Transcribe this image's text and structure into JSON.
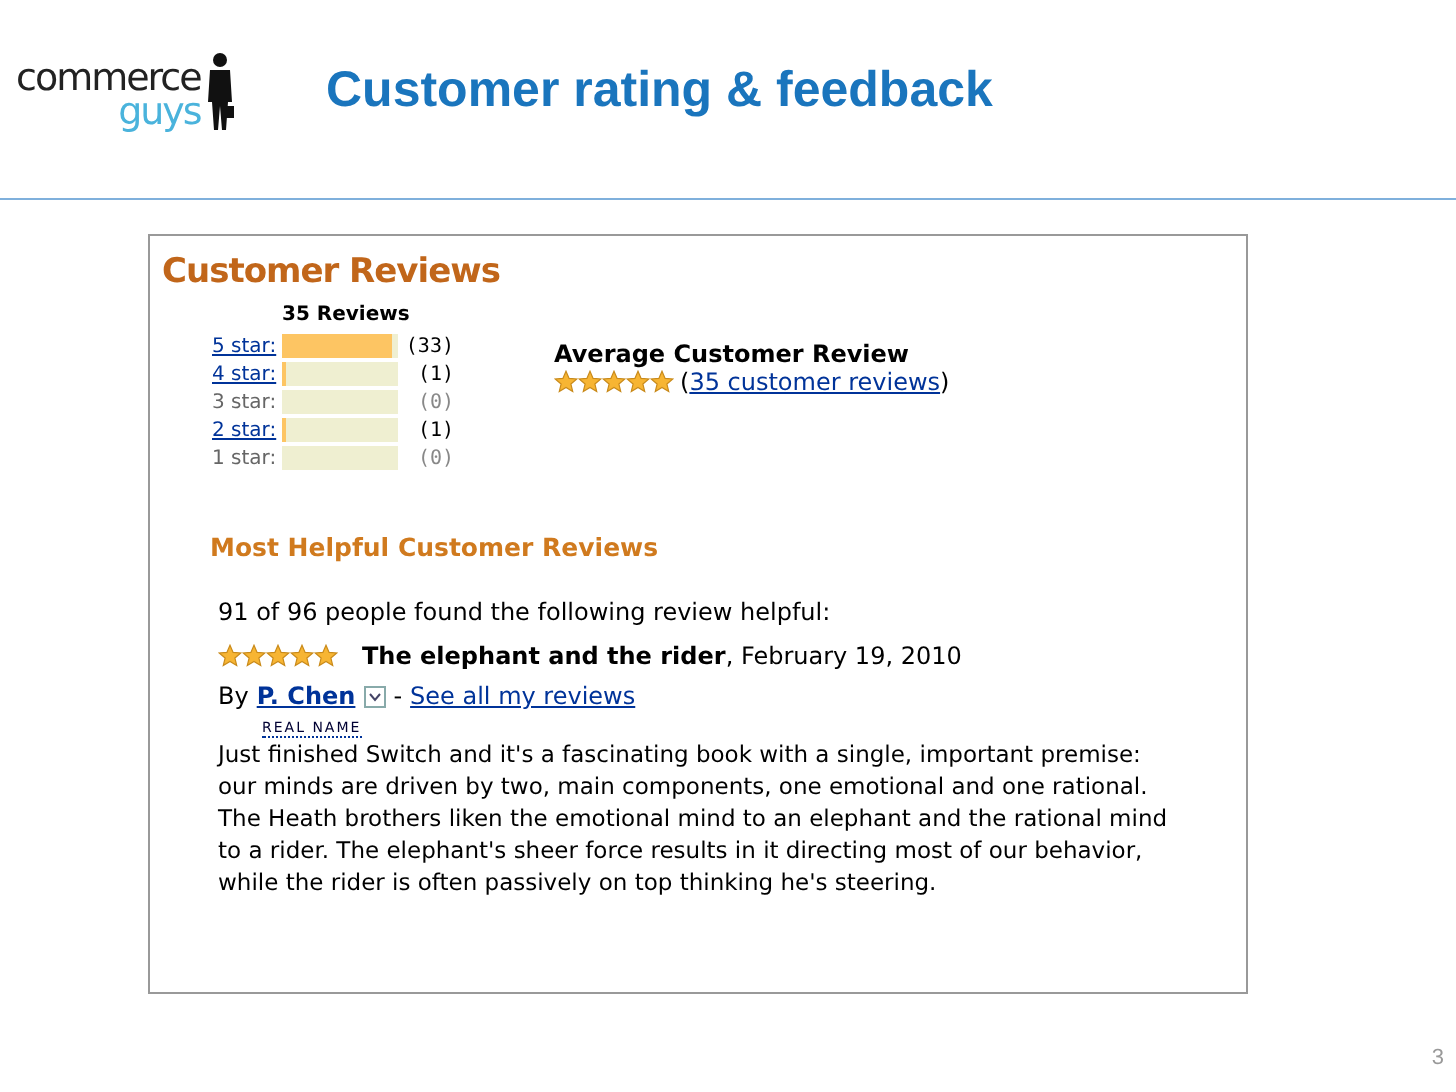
{
  "logo": {
    "line1": "commerce",
    "line2": "guys"
  },
  "title": "Customer rating & feedback",
  "reviews_panel": {
    "heading": "Customer Reviews",
    "total": "35 Reviews",
    "histogram": [
      {
        "label": "5 star:",
        "link": true,
        "level": 0.94,
        "count": "(33)"
      },
      {
        "label": "4 star:",
        "link": true,
        "level": 0.03,
        "count": "(1)"
      },
      {
        "label": "3 star:",
        "link": false,
        "level": 0,
        "count": "(0)"
      },
      {
        "label": "2 star:",
        "link": true,
        "level": 0.03,
        "count": "(1)"
      },
      {
        "label": "1 star:",
        "link": false,
        "level": 0,
        "count": "(0)"
      }
    ],
    "average": {
      "heading": "Average Customer Review",
      "stars": 5,
      "open": "(",
      "link": "35 customer reviews",
      "close": ")"
    },
    "helpful_heading": "Most Helpful Customer Reviews",
    "review": {
      "helpful": "91 of 96 people found the following review helpful:",
      "stars": 5,
      "title": "The elephant and the rider",
      "date": ", February 19, 2010",
      "by": "By",
      "author": "P. Chen",
      "separator": "-",
      "see_all": "See all my reviews",
      "badge": "REAL NAME",
      "body": "Just finished Switch and it's a fascinating book with a single, important premise: our minds are driven by two, main components, one emotional and one rational. The Heath brothers liken the emotional mind to an elephant and the rational mind to a rider. The elephant's sheer force results in it directing most of our behavior, while the rider is often passively on top thinking he's steering."
    }
  },
  "page_number": "3"
}
